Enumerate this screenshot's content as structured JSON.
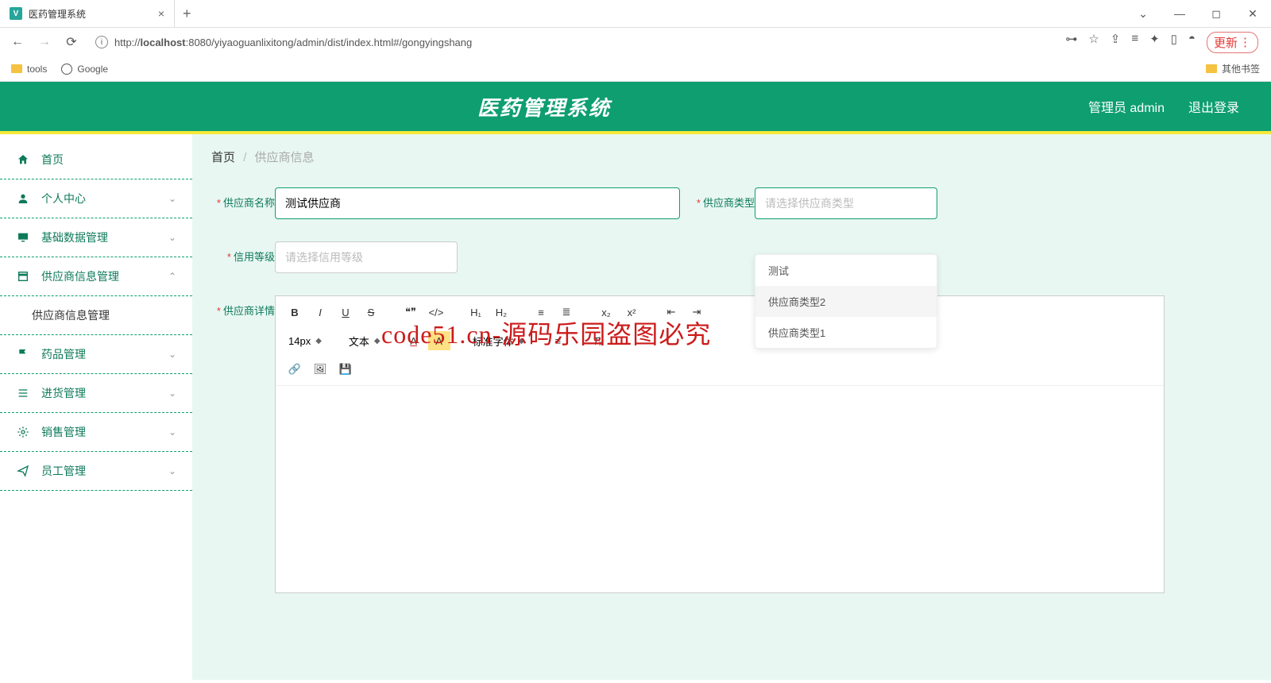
{
  "browser": {
    "tab_title": "医药管理系统",
    "url_prefix": "http://",
    "url_host": "localhost",
    "url_rest": ":8080/yiyaoguanlixitong/admin/dist/index.html#/gongyingshang",
    "update_label": "更新",
    "bookmarks": {
      "tools": "tools",
      "google": "Google",
      "other": "其他书签"
    }
  },
  "header": {
    "title": "医药管理系统",
    "user": "管理员 admin",
    "logout": "退出登录"
  },
  "sidebar": {
    "home": "首页",
    "personal": "个人中心",
    "basedata": "基础数据管理",
    "supplier": "供应商信息管理",
    "supplier_sub": "供应商信息管理",
    "drug": "药品管理",
    "stock": "进货管理",
    "sale": "销售管理",
    "staff": "员工管理"
  },
  "breadcrumb": {
    "home": "首页",
    "current": "供应商信息"
  },
  "form": {
    "name_label": "供应商名称",
    "name_value": "测试供应商",
    "type_label": "供应商类型",
    "type_placeholder": "请选择供应商类型",
    "credit_label": "信用等级",
    "credit_placeholder": "请选择信用等级",
    "detail_label": "供应商详情",
    "dropdown": {
      "opt1": "测试",
      "opt2": "供应商类型2",
      "opt3": "供应商类型1"
    }
  },
  "editor": {
    "font_size": "14px",
    "text_label": "文本",
    "font_family": "标准字体"
  },
  "watermark": "code51.cn-源码乐园盗图必究"
}
